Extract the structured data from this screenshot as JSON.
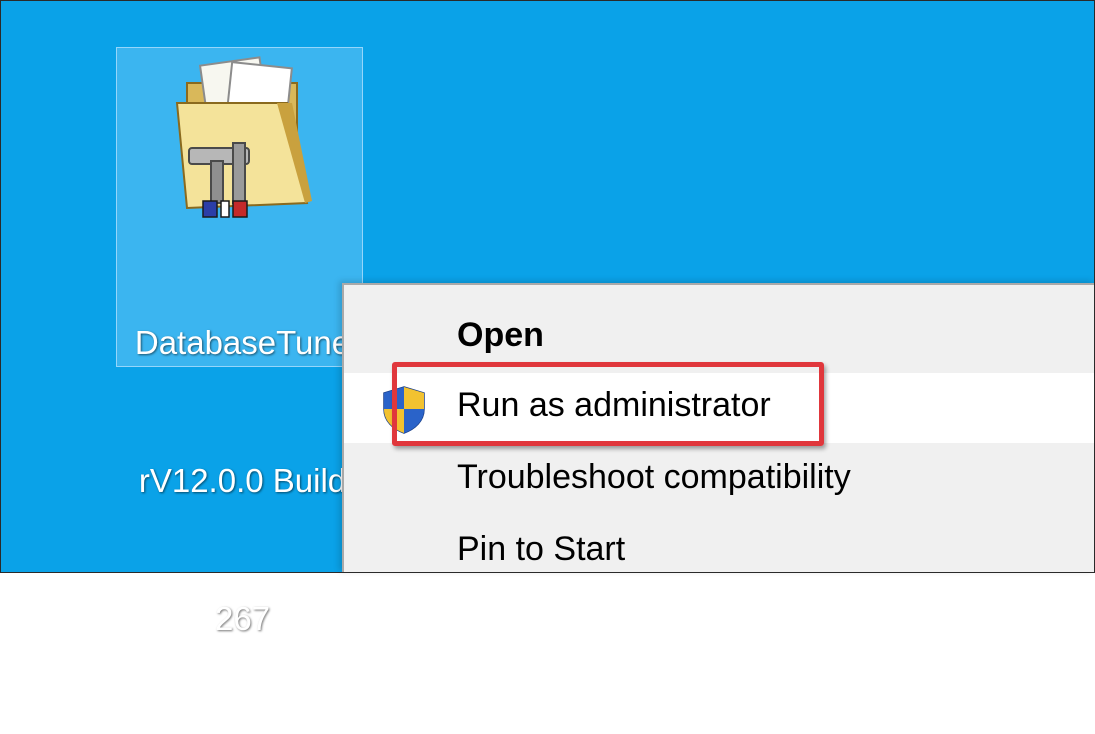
{
  "desktop": {
    "background_color": "#0aa2e8",
    "icon": {
      "label_lines": [
        "DatabaseTune",
        "rV12.0.0 Build",
        "267"
      ],
      "icon_name": "folder-with-tools-icon"
    }
  },
  "context_menu": {
    "items": [
      {
        "label": "Open",
        "bold": true,
        "icon": null
      },
      {
        "label": "Run as administrator",
        "bold": false,
        "icon": "uac-shield-icon",
        "highlighted": true
      },
      {
        "label": "Troubleshoot compatibility",
        "bold": false,
        "icon": null
      },
      {
        "label": "Pin to Start",
        "bold": false,
        "icon": null
      }
    ]
  },
  "annotation": {
    "highlight_color": "#e0373c",
    "target": "Run as administrator"
  }
}
